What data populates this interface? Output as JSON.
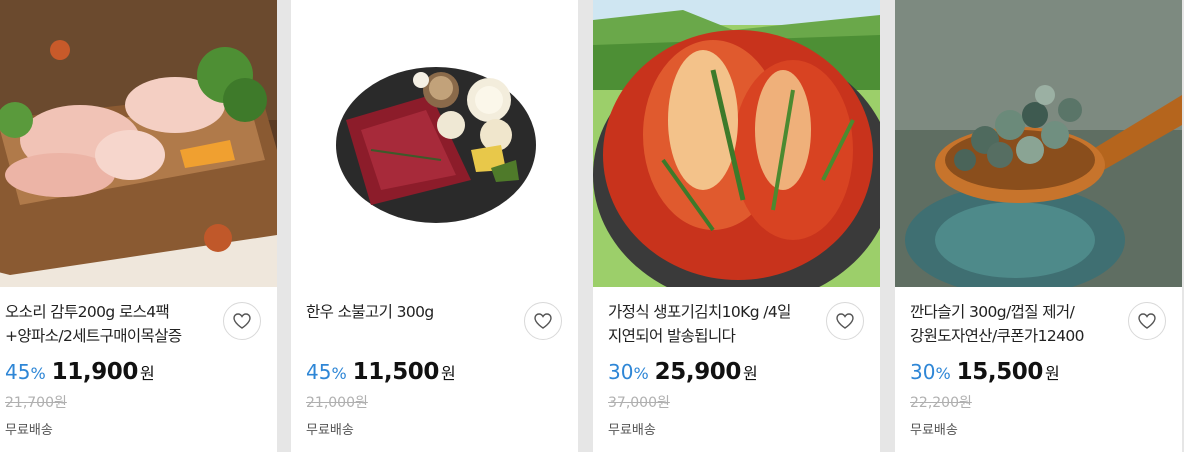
{
  "currency_won": "원",
  "percent_sign": "%",
  "products": [
    {
      "title": "오소리 감투200g 로스4팩+양파소/2세트구매이목살증",
      "discount": "45",
      "price": "11,900",
      "original_price": "21,700원",
      "shipping": "무료배송"
    },
    {
      "title": "한우 소불고기 300g",
      "discount": "45",
      "price": "11,500",
      "original_price": "21,000원",
      "shipping": "무료배송"
    },
    {
      "title": "가정식 생포기김치10Kg /4일 지연되어 발송됩니다",
      "discount": "30",
      "price": "25,900",
      "original_price": "37,000원",
      "shipping": "무료배송"
    },
    {
      "title": "깐다슬기 300g/껍질 제거/강원도자연산/쿠폰가12400",
      "discount": "30",
      "price": "15,500",
      "original_price": "22,200원",
      "shipping": "무료배송"
    }
  ],
  "colors": {
    "discount": "#2e86d6",
    "price": "#111111",
    "original": "#b0b0b0"
  }
}
